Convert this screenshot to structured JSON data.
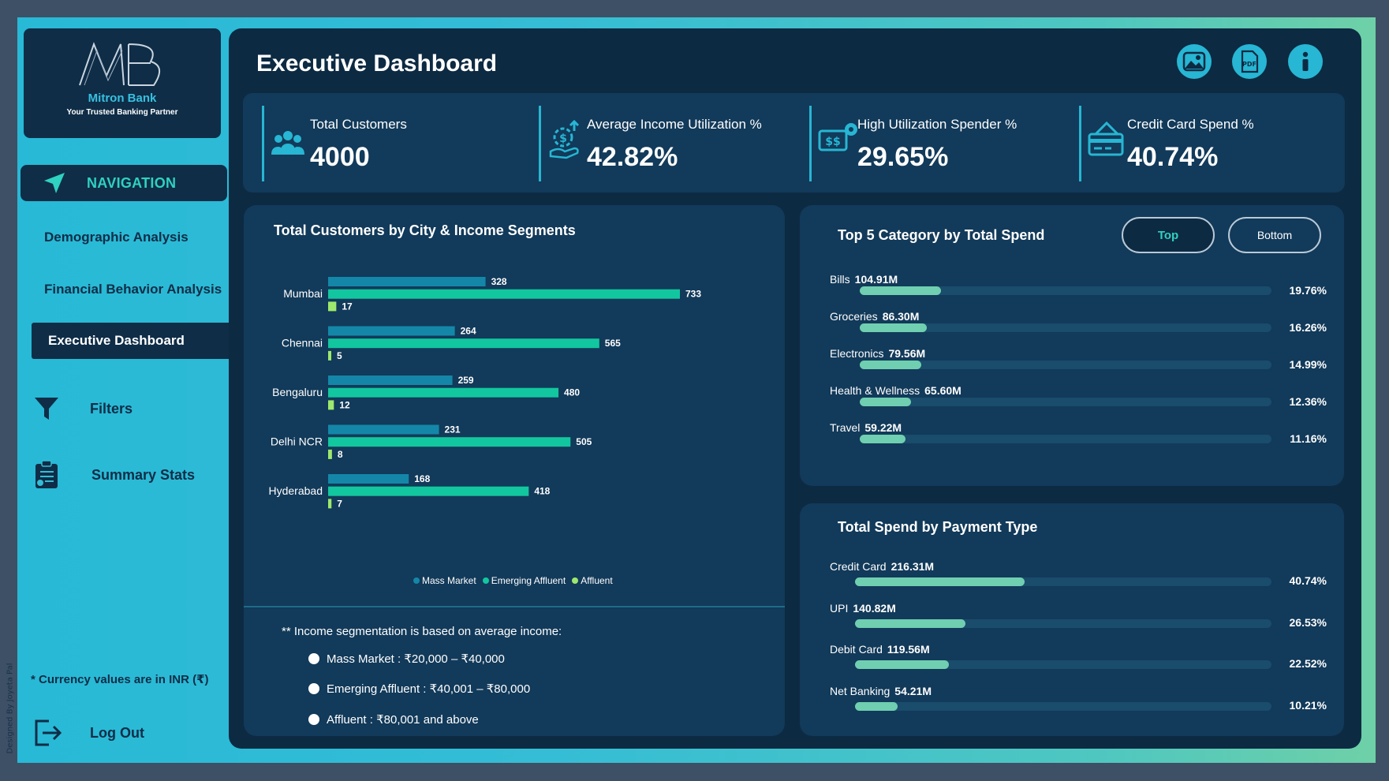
{
  "credit": "Designed By Joyeta Pal",
  "logo": {
    "name": "Mitron Bank",
    "tagline": "Your Trusted Banking Partner"
  },
  "sidebar": {
    "nav_label": "NAVIGATION",
    "links": [
      {
        "label": "Demographic Analysis"
      },
      {
        "label": "Financial Behavior Analysis"
      }
    ],
    "active_link": "Executive Dashboard",
    "filters_label": "Filters",
    "summary_label": "Summary Stats",
    "currency_note": "* Currency values are in INR (₹)",
    "logout_label": "Log Out"
  },
  "header": {
    "title": "Executive Dashboard",
    "icons": [
      "image-icon",
      "pdf-icon",
      "info-icon"
    ]
  },
  "kpis": [
    {
      "label": "Total Customers",
      "value": "4000",
      "icon": "customers-icon"
    },
    {
      "label": "Average Income Utilization %",
      "value": "42.82%",
      "icon": "income-utilization-icon"
    },
    {
      "label": "High Utilization Spender %",
      "value": "29.65%",
      "icon": "spender-icon"
    },
    {
      "label": "Credit Card Spend %",
      "value": "40.74%",
      "icon": "credit-card-icon"
    }
  ],
  "city_panel": {
    "title": "Total Customers by City & Income Segments",
    "legend": [
      "Mass Market",
      "Emerging Affluent",
      "Affluent"
    ],
    "note": "** Income segmentation is based on average income:",
    "segments": [
      "Mass Market : ₹20,000 – ₹40,000",
      "Emerging Affluent : ₹40,001 – ₹80,000",
      "Affluent : ₹80,001 and above"
    ]
  },
  "chart_data": {
    "type": "bar",
    "orientation": "horizontal",
    "title": "Total Customers by City & Income Segments",
    "categories": [
      "Mumbai",
      "Chennai",
      "Bengaluru",
      "Delhi NCR",
      "Hyderabad"
    ],
    "series": [
      {
        "name": "Mass Market",
        "values": [
          328,
          264,
          259,
          231,
          168
        ],
        "color": "#1487a8"
      },
      {
        "name": "Emerging Affluent",
        "values": [
          733,
          565,
          480,
          505,
          418
        ],
        "color": "#12c79f"
      },
      {
        "name": "Affluent",
        "values": [
          17,
          5,
          12,
          8,
          7
        ],
        "color": "#9ee86d"
      }
    ],
    "xlim": [
      0,
      800
    ],
    "grid": false,
    "legend_position": "bottom"
  },
  "category_panel": {
    "title": "Top 5 Category by Total Spend",
    "toggle_top": "Top",
    "toggle_bottom": "Bottom",
    "items": [
      {
        "name": "Bills",
        "amount": "104.91M",
        "pct_label": "19.76%",
        "pct": 19.76
      },
      {
        "name": "Groceries",
        "amount": "86.30M",
        "pct_label": "16.26%",
        "pct": 16.26
      },
      {
        "name": "Electronics",
        "amount": "79.56M",
        "pct_label": "14.99%",
        "pct": 14.99
      },
      {
        "name": "Health & Wellness",
        "amount": "65.60M",
        "pct_label": "12.36%",
        "pct": 12.36
      },
      {
        "name": "Travel",
        "amount": "59.22M",
        "pct_label": "11.16%",
        "pct": 11.16
      }
    ]
  },
  "payment_panel": {
    "title": "Total Spend by Payment Type",
    "items": [
      {
        "name": "Credit Card",
        "amount": "216.31M",
        "pct_label": "40.74%",
        "pct": 40.74
      },
      {
        "name": "UPI",
        "amount": "140.82M",
        "pct_label": "26.53%",
        "pct": 26.53
      },
      {
        "name": "Debit Card",
        "amount": "119.56M",
        "pct_label": "22.52%",
        "pct": 22.52
      },
      {
        "name": "Net Banking",
        "amount": "54.21M",
        "pct_label": "10.21%",
        "pct": 10.21
      }
    ]
  },
  "colors": {
    "main_bg": "#0d2a43",
    "panel_bg": "#123a5a",
    "accent": "#2fd1c0",
    "bar_fill": "#6fcfb0"
  }
}
